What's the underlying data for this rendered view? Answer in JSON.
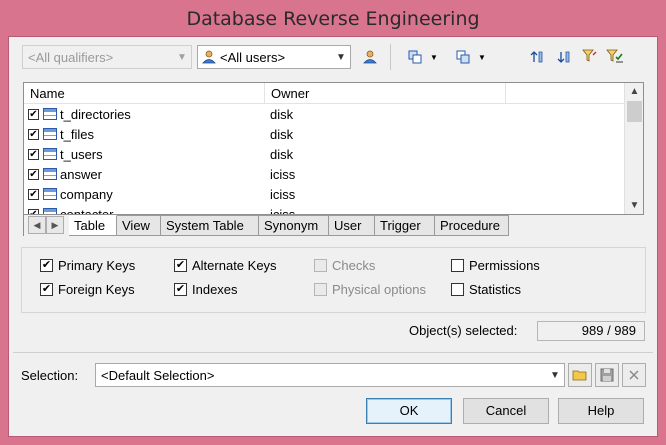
{
  "window": {
    "title": "Database Reverse Engineering"
  },
  "toolbar": {
    "qualifier": {
      "value": "<All qualifiers>"
    },
    "users": {
      "value": "<All users>"
    }
  },
  "list": {
    "columns": [
      "Name",
      "Owner"
    ],
    "rows": [
      {
        "name": "t_directories",
        "owner": "disk",
        "checked": true
      },
      {
        "name": "t_files",
        "owner": "disk",
        "checked": true
      },
      {
        "name": "t_users",
        "owner": "disk",
        "checked": true
      },
      {
        "name": "answer",
        "owner": "iciss",
        "checked": true
      },
      {
        "name": "company",
        "owner": "iciss",
        "checked": true
      },
      {
        "name": "contacter",
        "owner": "iciss",
        "checked": true
      }
    ]
  },
  "tabs": [
    "Table",
    "View",
    "System Table",
    "Synonym",
    "User",
    "Trigger",
    "Procedure"
  ],
  "active_tab": "Table",
  "options": [
    {
      "label": "Primary Keys",
      "checked": true,
      "enabled": true
    },
    {
      "label": "Alternate Keys",
      "checked": true,
      "enabled": true
    },
    {
      "label": "Checks",
      "checked": false,
      "enabled": false
    },
    {
      "label": "Permissions",
      "checked": false,
      "enabled": true
    },
    {
      "label": "Foreign Keys",
      "checked": true,
      "enabled": true
    },
    {
      "label": "Indexes",
      "checked": true,
      "enabled": true
    },
    {
      "label": "Physical options",
      "checked": false,
      "enabled": false
    },
    {
      "label": "Statistics",
      "checked": false,
      "enabled": true
    }
  ],
  "selection_count": {
    "label": "Object(s) selected:",
    "value": "989 / 989"
  },
  "selection": {
    "label": "Selection:",
    "value": "<Default Selection>"
  },
  "buttons": {
    "ok": "OK",
    "cancel": "Cancel",
    "help": "Help"
  },
  "colors": {
    "title_bar": "#d9748f",
    "dialog_bg": "#f0f0f0",
    "table_icon": "#2a5aa8"
  }
}
